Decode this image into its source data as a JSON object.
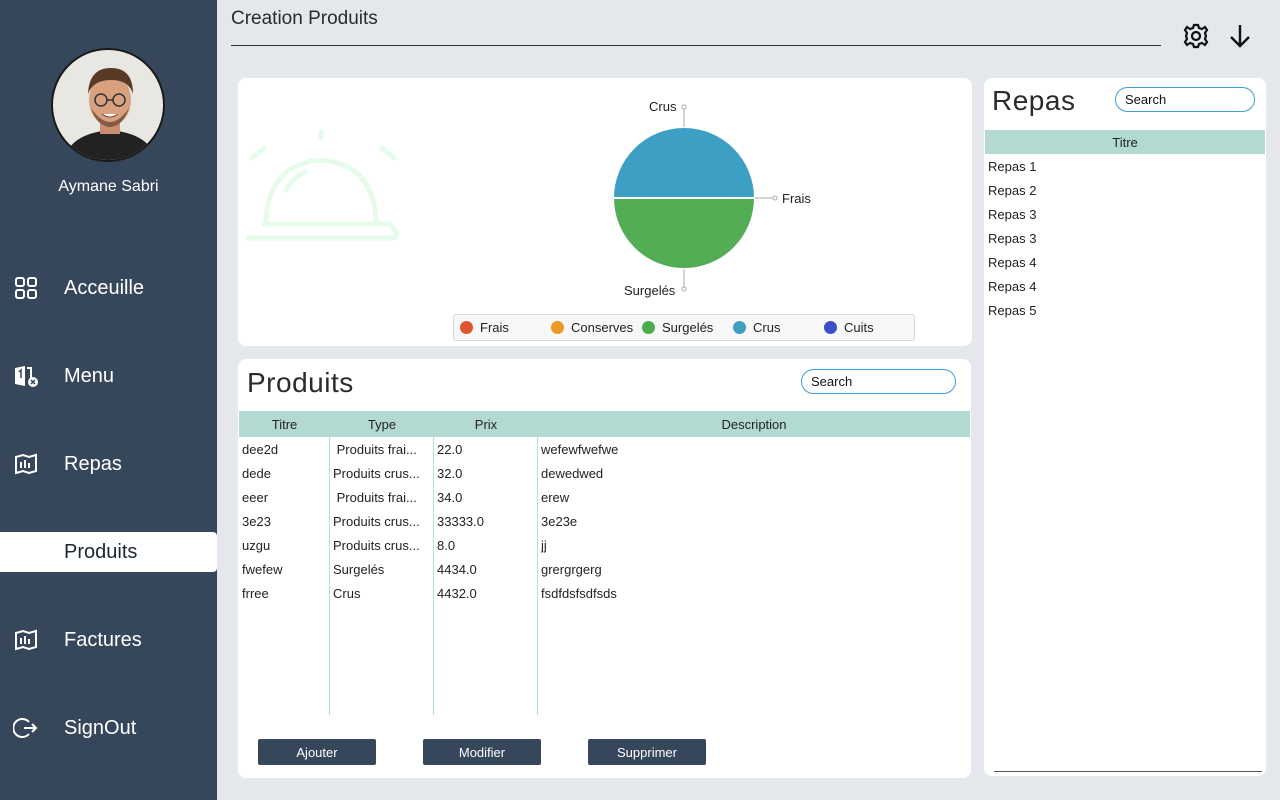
{
  "user": {
    "name": "Aymane Sabri"
  },
  "nav": [
    {
      "label": "Acceuille",
      "icon": "dashboard-icon"
    },
    {
      "label": "Menu",
      "icon": "menu-book-icon"
    },
    {
      "label": "Repas",
      "icon": "meal-icon"
    },
    {
      "label": "Produits",
      "icon": "",
      "active": true
    },
    {
      "label": "Factures",
      "icon": "invoice-icon"
    },
    {
      "label": "SignOut",
      "icon": "signout-icon"
    }
  ],
  "header": {
    "title": "Creation Produits",
    "settings_icon": "gear-icon",
    "download_icon": "arrow-down-icon"
  },
  "chart_data": {
    "type": "pie",
    "slices": [
      {
        "label": "Crus",
        "value": 50,
        "color": "#3d9fc4"
      },
      {
        "label": "Surgelés",
        "value": 50,
        "color": "#52ad54"
      }
    ],
    "slice_labels": {
      "top": "Crus",
      "right": "Frais",
      "bottom": "Surgelés"
    },
    "legend": [
      {
        "label": "Frais",
        "color": "#e0552f"
      },
      {
        "label": "Conserves",
        "color": "#ec9a25"
      },
      {
        "label": "Surgelés",
        "color": "#4aac4e"
      },
      {
        "label": "Crus",
        "color": "#3f9fc0"
      },
      {
        "label": "Cuits",
        "color": "#3a4fc4"
      }
    ],
    "legend_position": "bottom"
  },
  "produits": {
    "heading": "Produits",
    "search_placeholder": "Search",
    "columns": [
      "Titre",
      "Type",
      "Prix",
      "Description"
    ],
    "rows": [
      {
        "titre": "dee2d",
        "type": " Produits frai...",
        "prix": "22.0",
        "description": "wefewfwefwe"
      },
      {
        "titre": "dede",
        "type": "Produits crus...",
        "prix": "32.0",
        "description": "dewedwed"
      },
      {
        "titre": "eeer",
        "type": " Produits frai...",
        "prix": "34.0",
        "description": "erew"
      },
      {
        "titre": "3e23",
        "type": "Produits crus...",
        "prix": "33333.0",
        "description": "3e23e"
      },
      {
        "titre": "uzgu",
        "type": "Produits crus...",
        "prix": "8.0",
        "description": "jj"
      },
      {
        "titre": "fwefew",
        "type": "Surgelés",
        "prix": "4434.0",
        "description": "grergrgerg"
      },
      {
        "titre": "frree",
        "type": "Crus",
        "prix": "4432.0",
        "description": "fsdfdsfsdfsds"
      }
    ],
    "buttons": {
      "add": "Ajouter",
      "edit": "Modifier",
      "delete": "Supprimer"
    }
  },
  "repas": {
    "heading": "Repas",
    "search_placeholder": "Search",
    "column": "Titre",
    "items": [
      "Repas 1",
      "Repas 2",
      "Repas 3",
      "Repas 3",
      "Repas 4",
      "Repas 4",
      "Repas 5"
    ]
  }
}
